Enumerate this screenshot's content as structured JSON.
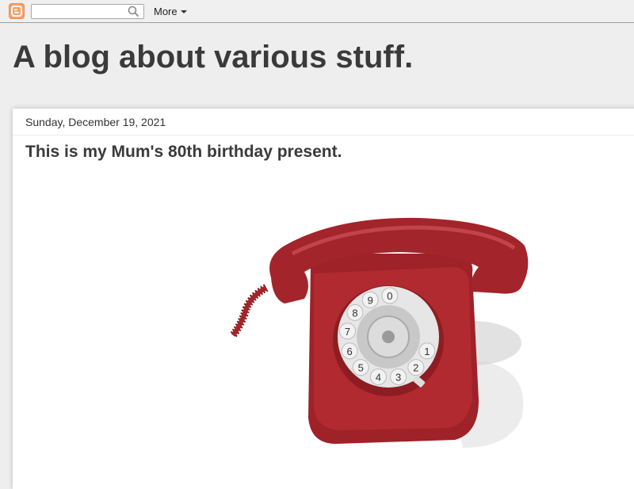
{
  "navbar": {
    "logo_icon": "blogger-logo-icon",
    "search": {
      "value": "",
      "placeholder": "",
      "icon": "search-icon"
    },
    "more_label": "More"
  },
  "header": {
    "title": "A blog about various stuff."
  },
  "post": {
    "date": "Sunday, December 19, 2021",
    "title": "This is my Mum's 80th birthday present.",
    "image_subject": "red-rotary-telephone",
    "dial_digits": [
      "1",
      "2",
      "3",
      "4",
      "5",
      "6",
      "7",
      "8",
      "9",
      "0"
    ]
  },
  "colors": {
    "page_bg": "#eeeeee",
    "navbar_bg": "#f0f0f0",
    "blogger_orange": "#f6a16b",
    "title_text": "#3a3a3a",
    "phone_red": "#a3242a"
  }
}
